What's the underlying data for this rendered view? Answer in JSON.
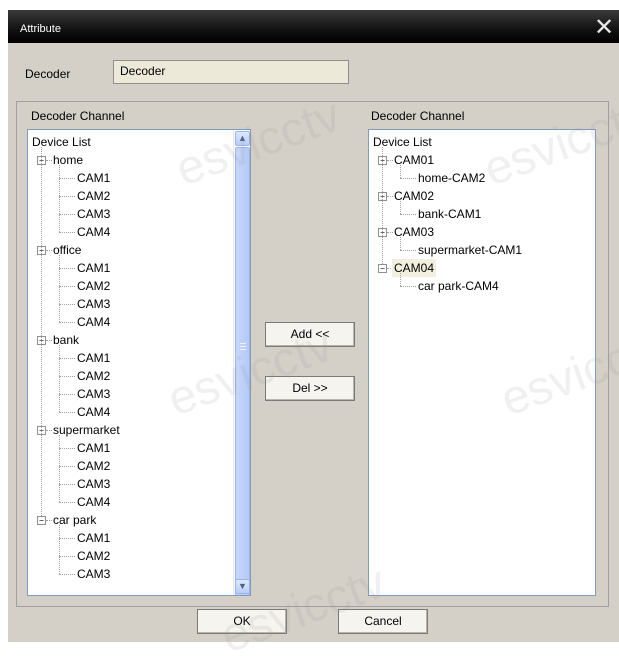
{
  "window": {
    "title": "Attribute",
    "close_glyph": "✕"
  },
  "decoder": {
    "label": "Decoder",
    "value": "Decoder"
  },
  "left_panel": {
    "label": "Decoder Channel",
    "root": "Device List",
    "groups": [
      {
        "name": "home",
        "items": [
          "CAM1",
          "CAM2",
          "CAM3",
          "CAM4"
        ]
      },
      {
        "name": "office",
        "items": [
          "CAM1",
          "CAM2",
          "CAM3",
          "CAM4"
        ]
      },
      {
        "name": "bank",
        "items": [
          "CAM1",
          "CAM2",
          "CAM3",
          "CAM4"
        ]
      },
      {
        "name": "supermarket",
        "items": [
          "CAM1",
          "CAM2",
          "CAM3",
          "CAM4"
        ]
      },
      {
        "name": "car park",
        "items": [
          "CAM1",
          "CAM2",
          "CAM3"
        ]
      }
    ],
    "collapse_glyph": "−",
    "scroll_up_glyph": "▲",
    "scroll_down_glyph": "▼"
  },
  "right_panel": {
    "label": "Decoder Channel",
    "root": "Device List",
    "groups": [
      {
        "name": "CAM01",
        "items": [
          "home-CAM2"
        ]
      },
      {
        "name": "CAM02",
        "items": [
          "bank-CAM1"
        ]
      },
      {
        "name": "CAM03",
        "items": [
          "supermarket-CAM1"
        ]
      },
      {
        "name": "CAM04",
        "items": [
          "car park-CAM4"
        ],
        "selected": true
      }
    ]
  },
  "buttons": {
    "add": "Add <<",
    "del": "Del >>",
    "ok": "OK",
    "cancel": "Cancel"
  },
  "watermark": "esvicctv"
}
